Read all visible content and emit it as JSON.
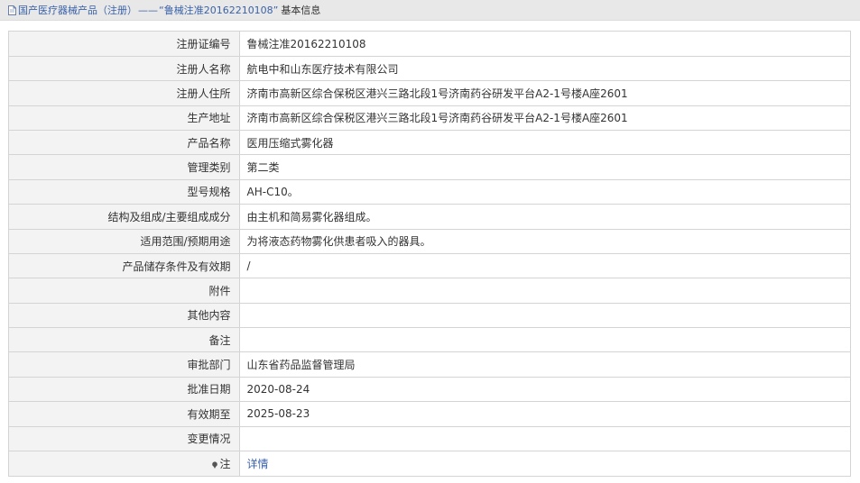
{
  "breadcrumb": {
    "root": "国产医疗器械产品（注册）",
    "separator": "——",
    "current": "“鲁械注准20162210108”",
    "suffix": "基本信息"
  },
  "rows": [
    {
      "label": "注册证编号",
      "value": "鲁械注准20162210108"
    },
    {
      "label": "注册人名称",
      "value": "航电中和山东医疗技术有限公司"
    },
    {
      "label": "注册人住所",
      "value": "济南市高新区综合保税区港兴三路北段1号济南药谷研发平台A2-1号楼A座2601"
    },
    {
      "label": "生产地址",
      "value": "济南市高新区综合保税区港兴三路北段1号济南药谷研发平台A2-1号楼A座2601"
    },
    {
      "label": "产品名称",
      "value": "医用压缩式雾化器"
    },
    {
      "label": "管理类别",
      "value": "第二类"
    },
    {
      "label": "型号规格",
      "value": "AH-C10。"
    },
    {
      "label": "结构及组成/主要组成成分",
      "value": "由主机和简易雾化器组成。"
    },
    {
      "label": "适用范围/预期用途",
      "value": "为将液态药物雾化供患者吸入的器具。"
    },
    {
      "label": "产品储存条件及有效期",
      "value": "/"
    },
    {
      "label": "附件",
      "value": ""
    },
    {
      "label": "其他内容",
      "value": ""
    },
    {
      "label": "备注",
      "value": ""
    },
    {
      "label": "审批部门",
      "value": "山东省药品监督管理局"
    },
    {
      "label": "批准日期",
      "value": "2020-08-24"
    },
    {
      "label": "有效期至",
      "value": "2025-08-23"
    },
    {
      "label": "变更情况",
      "value": ""
    }
  ],
  "note_row": {
    "label": "注",
    "link_text": "详情",
    "icon": "pin-icon"
  },
  "colors": {
    "link": "#3a62a8",
    "label_bg": "#f3f3f3",
    "border": "#d4d4d4",
    "topbar_bg": "#e8e8e8"
  }
}
